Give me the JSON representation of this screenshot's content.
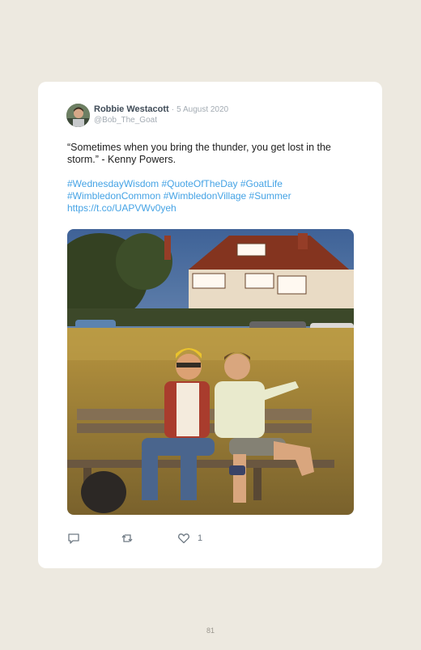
{
  "tweet": {
    "author_name": "Robbie Westacott",
    "separator": "·",
    "date": "5 August 2020",
    "handle": "@Bob_The_Goat",
    "text": "“Sometimes when you bring the thunder, you get lost in the storm.” - Kenny Powers.",
    "hashtag_line_1": "#WednesdayWisdom #QuoteOfTheDay #GoatLife",
    "hashtag_line_2": "#WimbledonCommon #WimbledonVillage #Summer",
    "link": "https://t.co/UAPVWv0yeh",
    "like_count": "1",
    "photo_icon": "photo-two-men-on-bench",
    "avatar_icon": "avatar-photo"
  },
  "actions": [
    {
      "icon": "reply-icon"
    },
    {
      "icon": "retweet-icon"
    },
    {
      "icon": "heart-icon"
    }
  ],
  "page": {
    "number": "81"
  },
  "colors": {
    "background": "#ede9e0",
    "card": "#ffffff",
    "link": "#45a3e5",
    "name": "#3f4b57",
    "muted": "#a3abb3"
  }
}
